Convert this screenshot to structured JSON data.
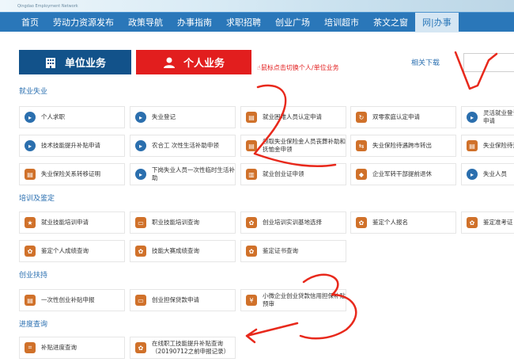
{
  "header": {
    "subtitle": "Qingdao Employment Network"
  },
  "nav": {
    "items": [
      "首页",
      "劳动力资源发布",
      "政策导航",
      "办事指南",
      "求职招聘",
      "创业广场",
      "培训超市",
      "茶文之窗",
      "网|办事"
    ],
    "active_index": 8
  },
  "tabs": {
    "unit_label": "单位业务",
    "personal_label": "个人业务",
    "hint": "鼠标点击切换个人/单位业务",
    "related": "相关下载"
  },
  "sections": {
    "employment": {
      "title": "就业失业",
      "items": [
        {
          "label": "个人求职",
          "icon": "circle-arrow-icon"
        },
        {
          "label": "失业登记",
          "icon": "circle-arrow-icon"
        },
        {
          "label": "就业困难人员认定申请",
          "icon": "document-icon"
        },
        {
          "label": "双零家庭认定申请",
          "icon": "refresh-icon"
        },
        {
          "label": "灵活就业登记申请",
          "icon": "circle-arrow-icon"
        },
        {
          "label": "技术技能提升补贴申请",
          "icon": "circle-arrow-icon"
        },
        {
          "label": "农合工 次性生活补助申领",
          "icon": "circle-arrow-icon"
        },
        {
          "label": "领取失业保险金人员丧葬补助和抚恤金申领",
          "icon": "document-icon"
        },
        {
          "label": "失业保险待遇跨市转出",
          "icon": "transfer-icon"
        },
        {
          "label": "失业保险待遇",
          "icon": "document-icon"
        },
        {
          "label": "失业保险关系转移证明",
          "icon": "document-icon"
        },
        {
          "label": "下岗失业人员一次性临时生活补助",
          "icon": "circle-arrow-icon"
        },
        {
          "label": "就业创业证申领",
          "icon": "book-icon"
        },
        {
          "label": "企业军转干部提前退休",
          "icon": "stamp-icon"
        },
        {
          "label": "失业人员",
          "icon": "circle-arrow-icon"
        }
      ]
    },
    "training": {
      "title": "培训及鉴定",
      "items": [
        {
          "label": "就业技能培训申请",
          "icon": "badge-icon"
        },
        {
          "label": "职业技能培训查询",
          "icon": "monitor-icon"
        },
        {
          "label": "创业培训实训基地选择",
          "icon": "certificate-icon"
        },
        {
          "label": "鉴定个人报名",
          "icon": "certificate-icon"
        },
        {
          "label": "鉴定准考证",
          "icon": "certificate-icon"
        },
        {
          "label": "鉴定个人成绩查询",
          "icon": "certificate-icon"
        },
        {
          "label": "技能大赛成绩查询",
          "icon": "certificate-icon"
        },
        {
          "label": "鉴定证书查询",
          "icon": "certificate-icon"
        }
      ]
    },
    "startup": {
      "title": "创业扶持",
      "items": [
        {
          "label": "一次性创业补贴申报",
          "icon": "document-icon"
        },
        {
          "label": "创业担保贷款申请",
          "icon": "monitor-icon"
        },
        {
          "label": "小微企业创业贷款信用担保补贴预审",
          "icon": "money-icon"
        }
      ]
    },
    "progress": {
      "title": "进度查询",
      "items": [
        {
          "label": "补贴进度查询",
          "icon": "scan-icon"
        },
        {
          "label": "在线职工技能提升补贴查询（20190712之前申报记录）",
          "icon": "certificate-icon"
        }
      ]
    }
  },
  "annotations": {
    "color": "#e8291c",
    "marks": [
      "1",
      "2",
      "3"
    ]
  }
}
